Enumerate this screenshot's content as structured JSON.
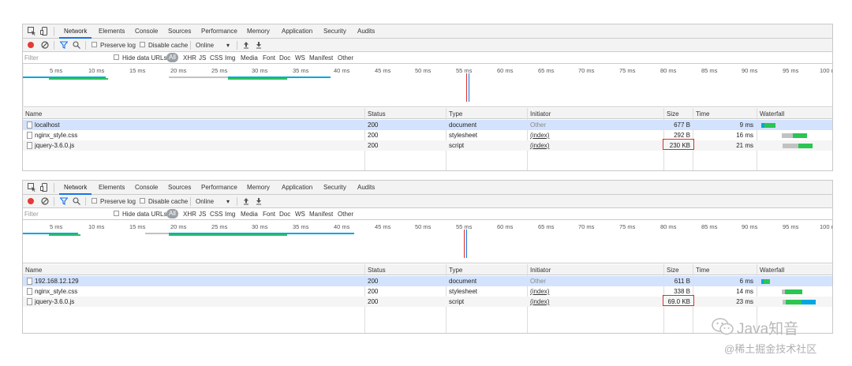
{
  "devtools": {
    "tabs": [
      "Network",
      "Elements",
      "Console",
      "Sources",
      "Performance",
      "Memory",
      "Application",
      "Security",
      "Audits"
    ],
    "toolbar": {
      "preserve_log": "Preserve log",
      "disable_cache": "Disable cache",
      "throttle_value": "Online"
    },
    "filter": {
      "placeholder": "Filter",
      "hide_data_urls": "Hide data URLs",
      "types": [
        "All",
        "XHR",
        "JS",
        "CSS",
        "Img",
        "Media",
        "Font",
        "Doc",
        "WS",
        "Manifest",
        "Other"
      ]
    },
    "timeline_ticks": [
      "5 ms",
      "10 ms",
      "15 ms",
      "20 ms",
      "25 ms",
      "30 ms",
      "35 ms",
      "40 ms",
      "45 ms",
      "50 ms",
      "55 ms",
      "60 ms",
      "65 ms",
      "70 ms",
      "75 ms",
      "80 ms",
      "85 ms",
      "90 ms",
      "95 ms",
      "100 r"
    ],
    "columns": [
      "Name",
      "Status",
      "Type",
      "Initiator",
      "Size",
      "Time",
      "Waterfall"
    ]
  },
  "panels": [
    {
      "rows": [
        {
          "name": "localhost",
          "status": "200",
          "type": "document",
          "initiator": "Other",
          "size": "677 B",
          "time": "9 ms"
        },
        {
          "name": "nginx_style.css",
          "status": "200",
          "type": "stylesheet",
          "initiator": "(index)",
          "size": "292 B",
          "time": "16 ms"
        },
        {
          "name": "jquery-3.6.0.js",
          "status": "200",
          "type": "script",
          "initiator": "(index)",
          "size": "230 KB",
          "time": "21 ms"
        }
      ]
    },
    {
      "rows": [
        {
          "name": "192.168.12.129",
          "status": "200",
          "type": "document",
          "initiator": "Other",
          "size": "611 B",
          "time": "6 ms"
        },
        {
          "name": "nginx_style.css",
          "status": "200",
          "type": "stylesheet",
          "initiator": "(index)",
          "size": "338 B",
          "time": "14 ms"
        },
        {
          "name": "jquery-3.6.0.js",
          "status": "200",
          "type": "script",
          "initiator": "(index)",
          "size": "69.0 KB",
          "time": "23 ms"
        }
      ]
    }
  ],
  "watermark": {
    "line1": "Java知音",
    "line2": "@稀土掘金技术社区"
  },
  "colors": {
    "waiting": "#c2c2c2",
    "download": "#2bc552",
    "ttfb": "#00a6e0",
    "highlight": "#d93025",
    "record": "#e53935"
  }
}
